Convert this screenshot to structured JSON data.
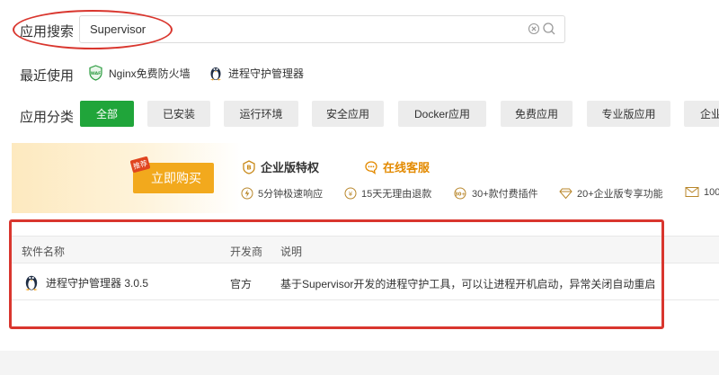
{
  "search": {
    "label": "应用搜索",
    "value": "Supervisor"
  },
  "recent": {
    "label": "最近使用",
    "items": [
      {
        "label": "Nginx免费防火墙",
        "icon": "waf-shield-icon"
      },
      {
        "label": "进程守护管理器",
        "icon": "penguin-icon"
      }
    ]
  },
  "category": {
    "label": "应用分类",
    "items": [
      "全部",
      "已安装",
      "运行环境",
      "安全应用",
      "Docker应用",
      "免费应用",
      "专业版应用",
      "企业"
    ],
    "active_index": 0
  },
  "banner": {
    "tag": "推荐",
    "buy_label": "立即购买",
    "enterprise_title": "企业版特权",
    "service_title": "在线客服",
    "perks": [
      {
        "icon": "lightning-icon",
        "label": "5分钟极速响应"
      },
      {
        "icon": "refund-icon",
        "label": "15天无理由退款"
      },
      {
        "icon": "plugin-30-icon",
        "label": "30+款付费插件"
      },
      {
        "icon": "diamond-icon",
        "label": "20+企业版专享功能"
      },
      {
        "icon": "mail-icon",
        "label": "100"
      }
    ]
  },
  "table": {
    "headers": {
      "name": "软件名称",
      "developer": "开发商",
      "description": "说明"
    },
    "rows": [
      {
        "name": "进程守护管理器 3.0.5",
        "developer": "官方",
        "description": "基于Supervisor开发的进程守护工具，可以让进程开机启动，异常关闭自动重启"
      }
    ]
  },
  "colors": {
    "accent_green": "#20a53a",
    "annotation_red": "#d9362e",
    "buy_orange": "#f2a91d",
    "service_orange": "#e38a00"
  }
}
